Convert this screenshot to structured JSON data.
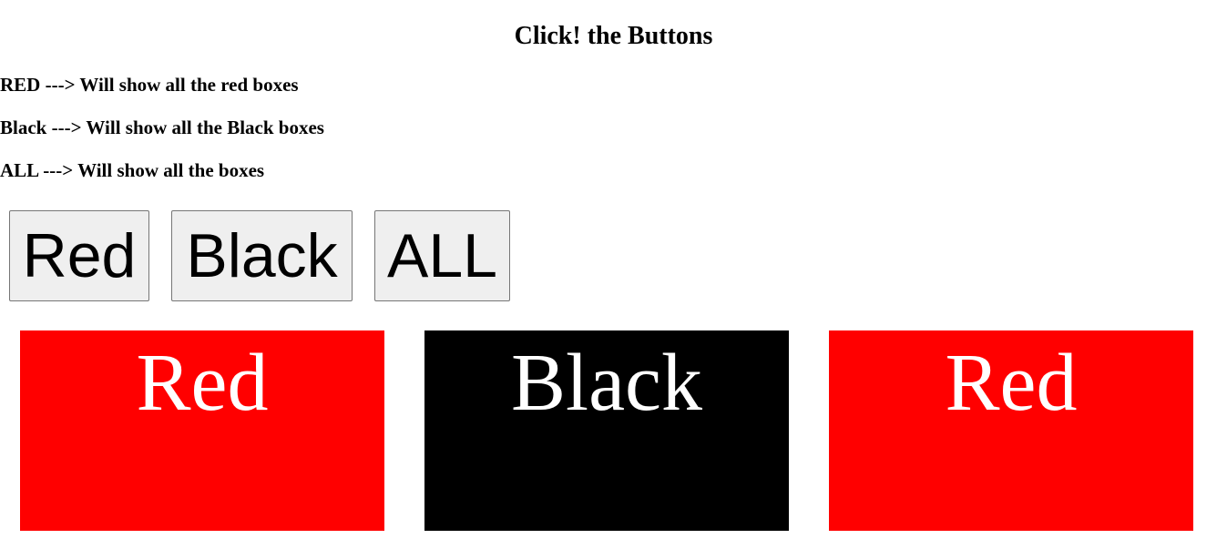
{
  "header": {
    "title": "Click! the Buttons"
  },
  "instructions": [
    "RED ---> Will show all the red boxes",
    "Black ---> Will show all the Black boxes",
    "ALL ---> Will show all the boxes"
  ],
  "buttons": [
    {
      "label": "Red"
    },
    {
      "label": "Black"
    },
    {
      "label": "ALL"
    }
  ],
  "boxes": [
    {
      "label": "Red",
      "color": "#ff0000"
    },
    {
      "label": "Black",
      "color": "#000000"
    },
    {
      "label": "Red",
      "color": "#ff0000"
    }
  ]
}
